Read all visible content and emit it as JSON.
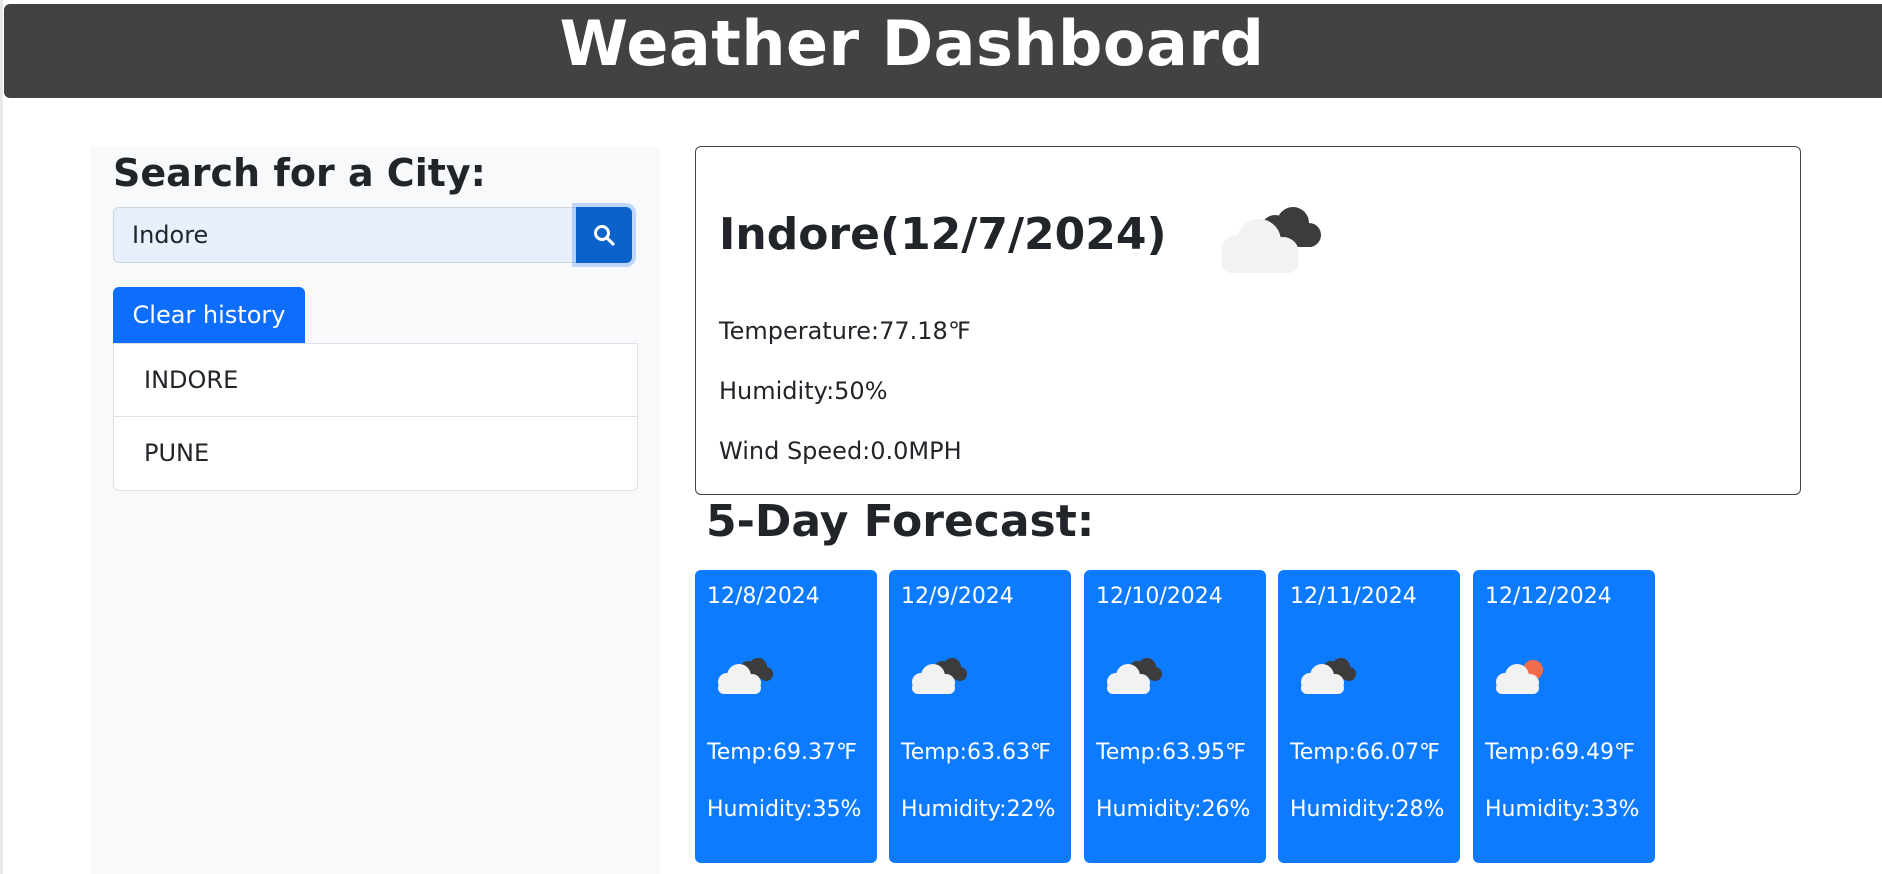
{
  "header": {
    "title": "Weather Dashboard"
  },
  "search": {
    "heading": "Search for a City:",
    "input_value": "Indore",
    "button_icon": "search-icon",
    "clear_label": "Clear history",
    "history": [
      "INDORE",
      "PUNE"
    ]
  },
  "current": {
    "title": "Indore(12/7/2024)",
    "icon": "cloud-icon",
    "temperature": "Temperature:77.18℉",
    "humidity": "Humidity:50%",
    "wind": "Wind Speed:0.0MPH"
  },
  "forecast": {
    "heading": "5-Day Forecast:",
    "days": [
      {
        "date": "12/8/2024",
        "icon": "cloud-icon",
        "temp": "Temp:69.37℉",
        "humidity": "Humidity:35%"
      },
      {
        "date": "12/9/2024",
        "icon": "cloud-icon",
        "temp": "Temp:63.63℉",
        "humidity": "Humidity:22%"
      },
      {
        "date": "12/10/2024",
        "icon": "cloud-icon",
        "temp": "Temp:63.95℉",
        "humidity": "Humidity:26%"
      },
      {
        "date": "12/11/2024",
        "icon": "cloud-icon",
        "temp": "Temp:66.07℉",
        "humidity": "Humidity:28%"
      },
      {
        "date": "12/12/2024",
        "icon": "sun-cloud-icon",
        "temp": "Temp:69.49℉",
        "humidity": "Humidity:33%"
      }
    ]
  },
  "colors": {
    "header_bg": "#424242",
    "primary": "#0d6efd",
    "forecast_card": "#0d7bff",
    "search_button": "#0b63c9",
    "sidebar_bg": "#f8f9fa"
  }
}
